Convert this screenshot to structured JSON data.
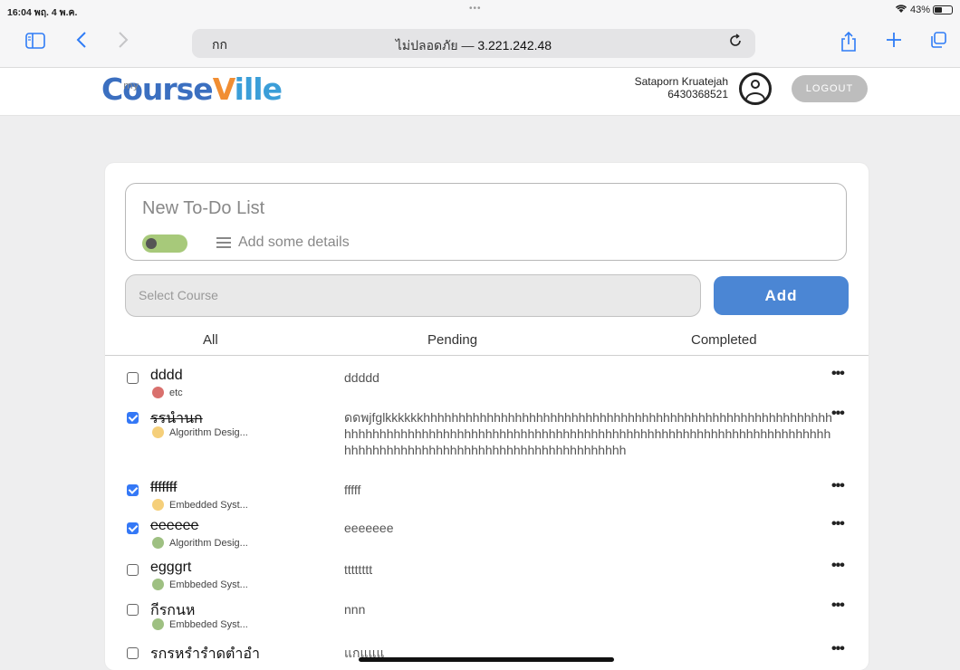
{
  "status": {
    "time": "16:04",
    "date": "พฤ. 4 พ.ค.",
    "battery": "43%"
  },
  "browser": {
    "aa_label": "กก",
    "address_prefix": "ไม่ปลอดภัย — ",
    "address_ip": "3.221.242.48"
  },
  "site": {
    "logo_my": "my",
    "logo_parts": [
      "Course",
      "V",
      "ille"
    ],
    "user_name": "Sataporn Kruatejah",
    "user_id": "6430368521",
    "logout_label": "LOGOUT"
  },
  "form": {
    "new_todo_placeholder": "New To-Do List",
    "details_placeholder": "Add some details",
    "select_placeholder": "Select Course",
    "add_label": "Add"
  },
  "tabs": [
    "All",
    "Pending",
    "Completed"
  ],
  "todos": [
    {
      "title": "dddd",
      "done": false,
      "course": "etc",
      "color": "#d9706d",
      "desc": "ddddd"
    },
    {
      "title": "รรนำนก",
      "done": true,
      "course": "Algorithm Desig...",
      "color": "#f5cf7a",
      "desc": "ดดพjfglkkkkkkhhhhhhhhhhhhhhhhhhhhhhhhhhhhhhhhhhhhhhhhhhhhhhhhhhhhhhhhhhhhhhhhhhhhhhhhhhhhhhhhhhhhhhhhhhhhhhhhhhhhhhhhhhhhhhhhhhhhhhhhhhhhhhhhhhhhhhhhhhhhhhhhhhhhhhhhhhhhhhhhhhhhhhh"
    },
    {
      "title": "fffffff",
      "done": true,
      "course": "Embedded Syst...",
      "color": "#f5cf7a",
      "desc": "fffff"
    },
    {
      "title": "eeeeee",
      "done": true,
      "course": "Algorithm Desig...",
      "color": "#9ec082",
      "desc": "eeeeeee"
    },
    {
      "title": "egggrt",
      "done": false,
      "course": "Embbeded Syst...",
      "color": "#9ec082",
      "desc": "tttttttt"
    },
    {
      "title": "กีรกนห",
      "done": false,
      "course": "Embbeded Syst...",
      "color": "#9ec082",
      "desc": "nnn"
    },
    {
      "title": "รกรหรำรำดตำอำ",
      "done": false,
      "course": "",
      "color": "",
      "desc": "แกแแแ"
    }
  ],
  "icons": {
    "sidebar": "sidebar-icon",
    "back": "back-icon",
    "forward": "forward-icon",
    "reload": "reload-icon",
    "share": "share-icon",
    "new_tab": "plus-icon",
    "tabs": "tabs-icon",
    "wifi": "wifi-icon",
    "battery": "battery-icon",
    "more": "more-icon"
  }
}
